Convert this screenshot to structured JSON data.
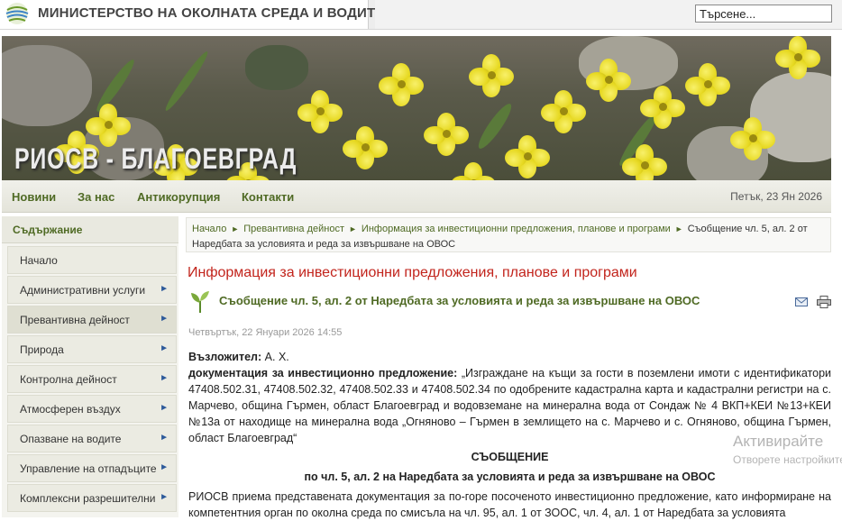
{
  "header": {
    "ministry": "МИНИСТЕРСТВО НА ОКОЛНАТА СРЕДА И ВОДИТЕ",
    "search_value": "Търсене..."
  },
  "banner": {
    "title": "РИОСВ - БЛАГОЕВГРАД"
  },
  "nav": {
    "items": [
      "Новини",
      "За нас",
      "Антикорупция",
      "Контакти"
    ],
    "date": "Петък, 23 Ян 2026"
  },
  "sidebar": {
    "heading": "Съдържание",
    "items": [
      "Начало",
      "Административни услуги",
      "Превантивна дейност",
      "Природа",
      "Контролна дейност",
      "Атмосферен въздух",
      "Опазване на водите",
      "Управление на отпадъците",
      "Комплексни разрешителни"
    ],
    "active_item": "Превантивна дейност"
  },
  "breadcrumb": {
    "items": [
      "Начало",
      "Превантивна дейност",
      "Информация за инвестиционни предложения, планове и програми"
    ],
    "current": "Съобщение чл. 5, ал. 2 от Наредбата за условията и реда за извършване на ОВОС"
  },
  "section_title": "Информация за инвестиционни предложения, планове и програми",
  "article": {
    "title": "Съобщение чл. 5, ал. 2 от Наредбата за условията и реда за извършване на ОВОС",
    "date": "Четвъртък, 22 Януари 2026 14:55",
    "assignor_label": "Възложител:",
    "assignor": "А. Х.",
    "doc_label": "документация за инвестиционно предложение:",
    "doc_text": "„Изграждане на къщи за гости в поземлени имоти с идентификатори 47408.502.31, 47408.502.32, 47408.502.33 и 47408.502.34 по одобрените кадастрална карта и кадастрални регистри на с. Марчево, община Гърмен, област Благоевград и водовземане на минерална вода от Сондаж № 4 ВКП+КЕИ №13+КЕИ №13а от находище на минерална вода „Огняново – Гърмен в землището на с. Марчево и с. Огняново, община Гърмен, област Благоевград“",
    "notice_heading": "СЪОБЩЕНИЕ",
    "notice_sub": "по чл. 5, ал. 2 на Наредбата за условията и реда за извършване на ОВОС",
    "body": "РИОСВ приема представената документация за по-горе посоченото инвестиционно предложение, като информиране на компетентния орган по околна среда по смисъла на чл. 95, ал. 1 от ЗООС, чл. 4, ал. 1 от Наредбата за условията"
  },
  "watermark": {
    "line1": "Активирайте",
    "line2": "Отворете настройките, за да активирате Windows."
  },
  "colors": {
    "nav_green": "#4f6a24",
    "section_red": "#c2241c"
  }
}
